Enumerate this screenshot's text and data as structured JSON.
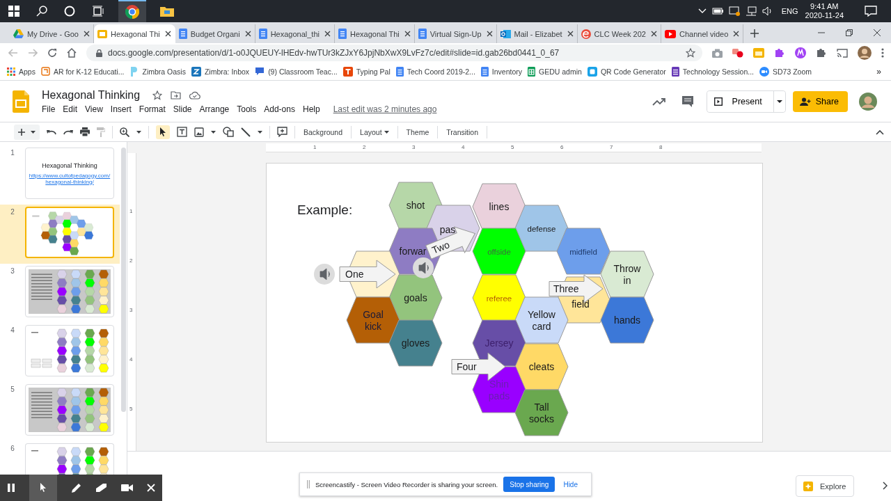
{
  "taskbar": {
    "language": "ENG",
    "time": "9:41 AM",
    "date": "2020-11-24"
  },
  "tabs": [
    {
      "title": "My Drive - Goo",
      "kind": "drive",
      "selected": false
    },
    {
      "title": "Hexagonal Thi",
      "kind": "slides",
      "selected": true
    },
    {
      "title": "Budget Organi",
      "kind": "docs",
      "selected": false
    },
    {
      "title": "Hexagonal_thi",
      "kind": "docs",
      "selected": false
    },
    {
      "title": "Hexagonal Thi",
      "kind": "docs",
      "selected": false
    },
    {
      "title": "Virtual Sign-Up",
      "kind": "docs",
      "selected": false
    },
    {
      "title": "Mail - Elizabet",
      "kind": "outlook",
      "selected": false
    },
    {
      "title": "CLC Week 202",
      "kind": "clc",
      "selected": false
    },
    {
      "title": "Channel video",
      "kind": "youtube",
      "selected": false
    }
  ],
  "address": {
    "url": "docs.google.com/presentation/d/1-o0JQUEUY-lHEdv-hwTUr3kZJxY6JpjNbXwX9LvFz7c/edit#slide=id.gab26bd0441_0_67"
  },
  "bookmarks": [
    {
      "label": "Apps",
      "kind": "apps"
    },
    {
      "label": "AR for K-12 Educati...",
      "kind": "ar"
    },
    {
      "label": "Zimbra Oasis",
      "kind": "oasis"
    },
    {
      "label": "Zimbra: Inbox",
      "kind": "zimbra"
    },
    {
      "label": "(9) Classroom Teac...",
      "kind": "chat"
    },
    {
      "label": "Typing Pal",
      "kind": "typing"
    },
    {
      "label": "Tech Coord 2019-2...",
      "kind": "docs"
    },
    {
      "label": "Inventory",
      "kind": "docs"
    },
    {
      "label": "GEDU admin",
      "kind": "sheets"
    },
    {
      "label": "QR Code Generator",
      "kind": "qr"
    },
    {
      "label": "Technology Session...",
      "kind": "forms"
    },
    {
      "label": "SD73 Zoom",
      "kind": "zoom"
    }
  ],
  "bookmarks_more": "»",
  "doc": {
    "title": "Hexagonal Thinking",
    "menus": [
      "File",
      "Edit",
      "View",
      "Insert",
      "Format",
      "Slide",
      "Arrange",
      "Tools",
      "Add-ons",
      "Help"
    ],
    "last_edit": "Last edit was 2 minutes ago",
    "present": "Present",
    "share": "Share"
  },
  "toolbar": [
    {
      "label": "Background",
      "dropdown": false
    },
    {
      "label": "Layout",
      "dropdown": true
    },
    {
      "label": "Theme",
      "dropdown": false
    },
    {
      "label": "Transition",
      "dropdown": false
    }
  ],
  "ruler": {
    "horizontal": [
      "1",
      "2",
      "3",
      "4",
      "5",
      "6",
      "7",
      "8"
    ],
    "vertical": [
      "1",
      "2",
      "3",
      "4",
      "5"
    ]
  },
  "slides": [
    {
      "number": "1",
      "kind": "title",
      "selected": false,
      "title": "Hexagonal Thinking",
      "link": "https://www.cultofpedagogy.com/hexagonal-thinking/"
    },
    {
      "number": "2",
      "kind": "example",
      "selected": true
    },
    {
      "number": "3",
      "kind": "instructions",
      "selected": false
    },
    {
      "number": "4",
      "kind": "practice",
      "selected": false
    },
    {
      "number": "5",
      "kind": "instructions",
      "selected": false
    },
    {
      "number": "6",
      "kind": "practice",
      "selected": false
    }
  ],
  "slide": {
    "heading": "Example:",
    "hexes": [
      {
        "label": "shot",
        "color": "#b6d7a8"
      },
      {
        "label": "pas",
        "color": "#d9d2e9"
      },
      {
        "label": "lines",
        "color": "#ead1dc"
      },
      {
        "label": "defense",
        "color": "#9fc5e8"
      },
      {
        "label": "forwar",
        "color": "#8e7cc3"
      },
      {
        "label": "offside",
        "color": "#00ff00"
      },
      {
        "label": "midfield",
        "color": "#6d9eeb"
      },
      {
        "color": "#fff2cc"
      },
      {
        "label": "Throw in",
        "color": "#d9ead3"
      },
      {
        "label": "goals",
        "color": "#93c47d"
      },
      {
        "label": "referee",
        "color": "#ffff00"
      },
      {
        "label": "field",
        "color": "#ffe599"
      },
      {
        "label": "Goal kick",
        "color": "#b45f06"
      },
      {
        "label": "Yellow card",
        "color": "#c9daf8"
      },
      {
        "label": "hands",
        "color": "#3c78d8"
      },
      {
        "label": "gloves",
        "color": "#45818e"
      },
      {
        "label": "Jersey",
        "color": "#674ea7"
      },
      {
        "label": "cleats",
        "color": "#ffd966"
      },
      {
        "label": "Shin pads",
        "color": "#9900ff"
      },
      {
        "label": "Tall socks",
        "color": "#6aa84f"
      }
    ],
    "arrows": [
      {
        "label": "One"
      },
      {
        "label": "Two"
      },
      {
        "label": "Three"
      },
      {
        "label": "Four"
      }
    ]
  },
  "share_bar": {
    "message": "Screencastify - Screen Video Recorder is sharing your screen.",
    "stop": "Stop sharing",
    "hide": "Hide"
  },
  "explore": "Explore"
}
